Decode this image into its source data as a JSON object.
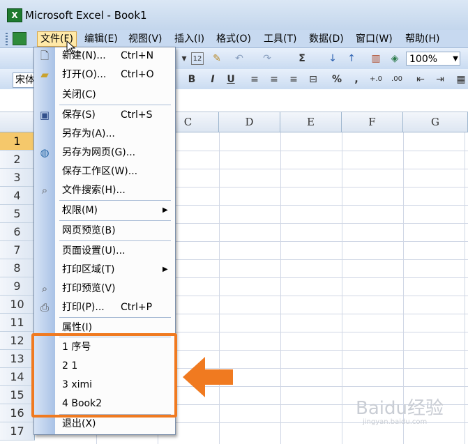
{
  "window": {
    "title": "Microsoft Excel - Book1",
    "app_icon": "X"
  },
  "menubar": {
    "items": [
      {
        "label": "文件(F)"
      },
      {
        "label": "编辑(E)"
      },
      {
        "label": "视图(V)"
      },
      {
        "label": "插入(I)"
      },
      {
        "label": "格式(O)"
      },
      {
        "label": "工具(T)"
      },
      {
        "label": "数据(D)"
      },
      {
        "label": "窗口(W)"
      },
      {
        "label": "帮助(H)"
      }
    ]
  },
  "toolbar": {
    "zoom": "100%",
    "font": "宋体",
    "sum_symbol": "Σ",
    "bold": "B",
    "italic": "I",
    "underline": "U",
    "percent": "%",
    "comma": ",",
    "dec_inc": "+.0",
    "dec_dec": ".00"
  },
  "sheet": {
    "columns": [
      "C",
      "D",
      "E",
      "F",
      "G"
    ],
    "rows": [
      "1",
      "2",
      "3",
      "4",
      "5",
      "6",
      "7",
      "8",
      "9",
      "10",
      "11",
      "12",
      "13",
      "14",
      "15",
      "16",
      "17"
    ],
    "selected_row": "1"
  },
  "file_menu": {
    "items": [
      {
        "label": "新建(N)...",
        "shortcut": "Ctrl+N",
        "icon": "new-file-icon"
      },
      {
        "label": "打开(O)...",
        "shortcut": "Ctrl+O",
        "icon": "open-folder-icon"
      },
      {
        "label": "关闭(C)",
        "shortcut": ""
      },
      {
        "label": "保存(S)",
        "shortcut": "Ctrl+S",
        "icon": "save-icon"
      },
      {
        "label": "另存为(A)...",
        "shortcut": ""
      },
      {
        "label": "另存为网页(G)...",
        "shortcut": "",
        "icon": "web-page-icon"
      },
      {
        "label": "保存工作区(W)...",
        "shortcut": ""
      },
      {
        "label": "文件搜索(H)...",
        "shortcut": "",
        "icon": "file-search-icon"
      },
      {
        "label": "权限(M)",
        "shortcut": "",
        "submenu": true
      },
      {
        "label": "网页预览(B)",
        "shortcut": ""
      },
      {
        "label": "页面设置(U)...",
        "shortcut": ""
      },
      {
        "label": "打印区域(T)",
        "shortcut": "",
        "submenu": true
      },
      {
        "label": "打印预览(V)",
        "shortcut": "",
        "icon": "print-preview-icon"
      },
      {
        "label": "打印(P)...",
        "shortcut": "Ctrl+P",
        "icon": "print-icon"
      },
      {
        "label": "属性(I)",
        "shortcut": ""
      },
      {
        "label": "1 序号",
        "shortcut": ""
      },
      {
        "label": "2 1",
        "shortcut": ""
      },
      {
        "label": "3 ximi",
        "shortcut": ""
      },
      {
        "label": "4 Book2",
        "shortcut": ""
      },
      {
        "label": "退出(X)",
        "shortcut": ""
      }
    ]
  },
  "colors": {
    "highlight": "#f07a20",
    "selected_row": "#f5c86b",
    "menu_strip": "#a9c2e6"
  },
  "watermark": {
    "brand": "Baidu经验",
    "url": "jingyan.baidu.com"
  }
}
